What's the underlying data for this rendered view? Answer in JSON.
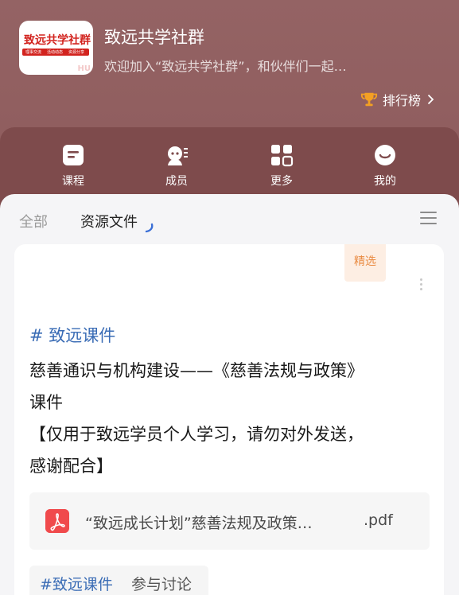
{
  "group": {
    "logo_text": "致远共学社群",
    "logo_bar_items": [
      "理事交流",
      "活动动态",
      "资源分享"
    ],
    "logo_corner": "HU",
    "title": "致远共学社群",
    "description": "欢迎加入“致远共学社群”，和伙伴们一起…",
    "ranking_label": "排行榜"
  },
  "nav": {
    "items": [
      {
        "label": "课程",
        "icon": "course-icon"
      },
      {
        "label": "成员",
        "icon": "members-icon"
      },
      {
        "label": "更多",
        "icon": "grid-icon"
      },
      {
        "label": "我的",
        "icon": "smile-icon"
      }
    ]
  },
  "tabs": {
    "all": "全部",
    "resources": "资源文件"
  },
  "post": {
    "badge": "精选",
    "hashtag": "# 致远课件",
    "lines": [
      "慈善通识与机构建设——《慈善法规与政策》",
      "课件",
      "【仅用于致远学员个人学习，请勿对外发送，",
      "感谢配合】"
    ],
    "file_name": "“致远成长计划”慈善法规及政策…",
    "file_ext": ".pdf",
    "discussion_tag": "#致远课件",
    "discussion_text": "参与讨论"
  },
  "colors": {
    "header_bg": "#946364",
    "nav_bg": "#7e4b4c",
    "hashtag": "#3a6cb5",
    "badge_text": "#e98a41",
    "badge_bg": "#fdeee3",
    "pdf_red": "#f04a4c",
    "trophy": "#f3a023"
  }
}
